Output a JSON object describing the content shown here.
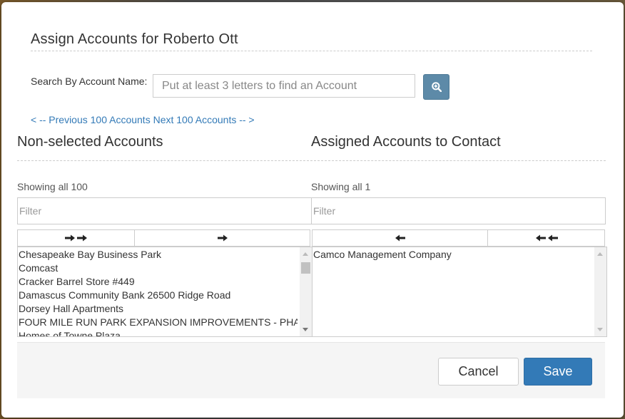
{
  "dialog": {
    "title": "Assign Accounts for Roberto Ott"
  },
  "search": {
    "label": "Search By Account Name:",
    "placeholder": "Put at least 3 letters to find an Account",
    "value": ""
  },
  "pager": {
    "previous": "< -- Previous 100 Accounts",
    "next": "Next 100 Accounts -- >"
  },
  "left": {
    "heading": "Non-selected Accounts",
    "showing": "Showing all 100",
    "filter_placeholder": "Filter",
    "items": [
      "Chesapeake Bay Business Park",
      "Comcast",
      "Cracker Barrel Store #449",
      "Damascus Community Bank 26500 Ridge Road",
      "Dorsey Hall Apartments",
      "FOUR MILE RUN PARK EXPANSION IMPROVEMENTS - PHASE II",
      "Homes of Towne Plaza"
    ]
  },
  "right": {
    "heading": "Assigned Accounts to Contact",
    "showing": "Showing all 1",
    "filter_placeholder": "Filter",
    "items": [
      "Camco Management Company"
    ]
  },
  "footer": {
    "cancel_label": "Cancel",
    "save_label": "Save"
  },
  "colors": {
    "primary": "#337ab7",
    "search_button": "#5d8aa8",
    "link": "#337ab7"
  },
  "icons": {
    "search": "zoom-in-icon",
    "move_all_right": "double-arrow-right-icon",
    "move_right": "arrow-right-icon",
    "move_left": "arrow-left-icon",
    "move_all_left": "double-arrow-left-icon"
  }
}
